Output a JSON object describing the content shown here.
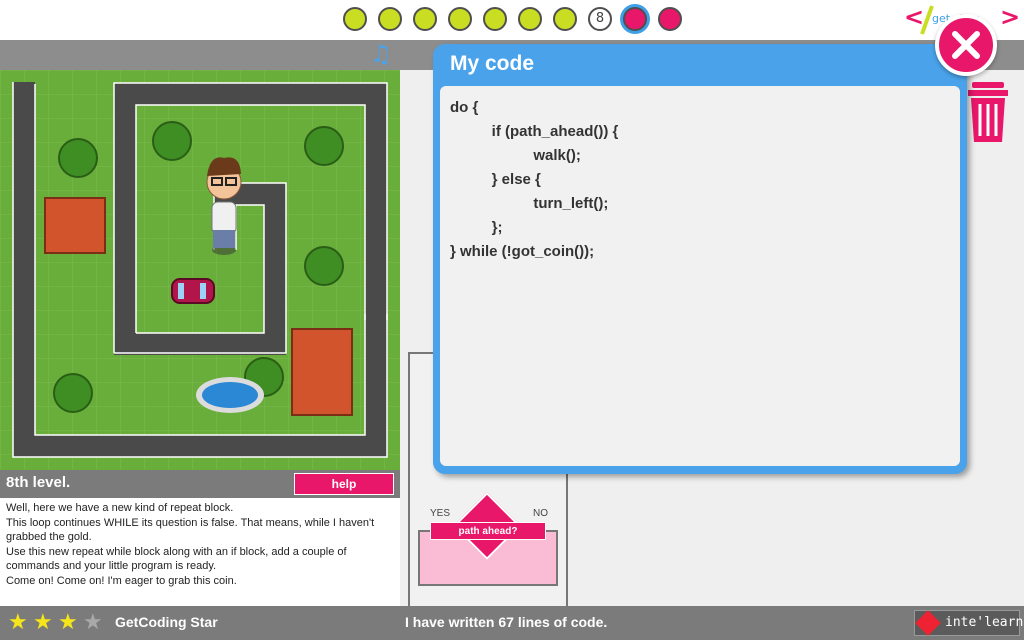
{
  "levels": {
    "dots": [
      {
        "state": "done"
      },
      {
        "state": "done"
      },
      {
        "state": "done"
      },
      {
        "state": "done"
      },
      {
        "state": "done"
      },
      {
        "state": "done"
      },
      {
        "state": "done"
      },
      {
        "state": "current",
        "label": "8"
      },
      {
        "state": "locked-active"
      },
      {
        "state": "locked"
      }
    ]
  },
  "logo": {
    "left": "<",
    "text": "get_ding",
    "right": ">"
  },
  "dialog": {
    "title": "My code",
    "code_lines": [
      "do {",
      "          if (path_ahead()) {",
      "                    walk();",
      "          } else {",
      "                    turn_left();",
      "          };",
      "} while (!got_coin());"
    ]
  },
  "instructions": {
    "level_title": "8th level.",
    "help_label": "help",
    "paragraphs": [
      "Well, here we have a new kind of repeat block.",
      "This loop continues WHILE its question is false. That means, while I haven't grabbed the gold.",
      "Use this new repeat while block along with an if block, add a couple of commands and your little program is ready.",
      "Come on! Come on! I'm eager to grab this coin."
    ]
  },
  "if_block": {
    "yes": "YES",
    "no": "NO",
    "condition": "path ahead?"
  },
  "bottom": {
    "stars_filled": 3,
    "stars_total": 4,
    "star_title": "GetCoding Star",
    "lines_status": "I have written 67 lines of code.",
    "brand": "inte'learn"
  },
  "colors": {
    "accent_blue": "#4aa3ea",
    "brand_pink": "#e8176a",
    "done_green": "#c9dd22",
    "grass": "#69ad3a",
    "road": "#4a4a4a"
  }
}
